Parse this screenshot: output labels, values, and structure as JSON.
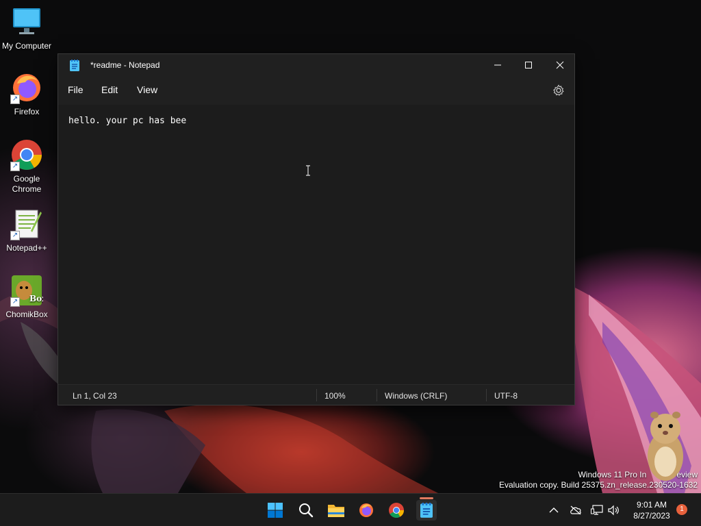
{
  "desktop": {
    "icons": [
      {
        "label": "My Computer"
      },
      {
        "label": "Firefox"
      },
      {
        "label": "Google Chrome"
      },
      {
        "label": "Notepad++"
      },
      {
        "label": "ChomikBox"
      }
    ]
  },
  "window": {
    "title": "*readme - Notepad",
    "menu": [
      "File",
      "Edit",
      "View"
    ],
    "content": "hello. your pc has bee",
    "status": {
      "position": "Ln 1, Col 23",
      "zoom": "100%",
      "line_ending": "Windows (CRLF)",
      "encoding": "UTF-8"
    }
  },
  "watermark": {
    "line1": "Windows 11 Pro In",
    "line1_tail": "eview",
    "line2": "Evaluation copy. Build 25375.zn_release.230520-1632"
  },
  "taskbar": {
    "apps": [
      "start-icon",
      "search-icon",
      "file-explorer-icon",
      "firefox-icon",
      "chrome-icon",
      "notepad-icon"
    ],
    "clock_time": "9:01 AM",
    "clock_date": "8/27/2023",
    "notification_count": "1"
  },
  "colors": {
    "window_bg": "#202020",
    "editor_bg": "#1c1c1c",
    "taskbar_bg": "#1c1c1c",
    "accent": "#e07a5f"
  }
}
